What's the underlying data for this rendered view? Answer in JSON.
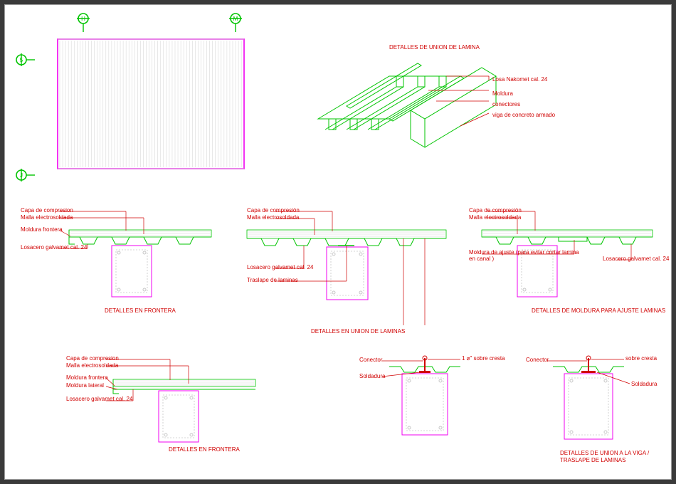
{
  "colors": {
    "green": "#00c400",
    "magenta": "#f000f0",
    "red": "#d00000",
    "hatch": "#c7c7c7"
  },
  "markers": {
    "h": "H",
    "m": "M",
    "s": "5",
    "j": "J"
  },
  "iso": {
    "title": "DETALLES DE UNION DE LAMINA",
    "labels": {
      "l1": "Losa Nakomet cal. 24",
      "l2": "Moldura",
      "l3": "conectores",
      "l4": "viga de concreto armado"
    }
  },
  "plan_note": "",
  "sections": {
    "front1": {
      "title": "DETALLES EN FRONTERA",
      "labels": {
        "capa": "Capa de compresion",
        "malla": "Malla electrosoldada",
        "mold": "Moldura frontera",
        "losa": "Losacero galvamet cal. 24"
      }
    },
    "union": {
      "title": "DETALLES EN UNION DE LAMINAS",
      "labels": {
        "capa": "Capa de compresión",
        "malla": "Malla electrosoldada",
        "losa": "Losacero galvamet cal. 24",
        "tras": "Traslape de laminas"
      }
    },
    "ajuste": {
      "title": "DETALLES DE MOLDURA PARA AJUSTE LAMINAS",
      "labels": {
        "capa": "Capa de compresión",
        "malla": "Malla electrosoldada",
        "mold": "Moldura de ajuste (para evitar cortar lamina en canal )",
        "losa": "Losacero galvamet cal. 24"
      }
    },
    "front2": {
      "title": "DETALLES EN FRONTERA",
      "labels": {
        "capa": "Capa de compresion",
        "malla": "Malla electrosoldada",
        "mold": "Moldura frontera",
        "lateral": "Moldura lateral",
        "losa": "Losacero galvamet cal. 24"
      }
    },
    "conn1": {
      "title": "",
      "labels": {
        "con": "Conector",
        "clip": "1 ⌀\" sobre cresta",
        "sold": "Soldadura"
      }
    },
    "conn2": {
      "title": "DETALLES DE UNION A LA VIGA / TRASLAPE DE LAMINAS",
      "labels": {
        "con": "Conector",
        "clip": "sobre cresta",
        "sold": "Soldadura"
      }
    }
  }
}
